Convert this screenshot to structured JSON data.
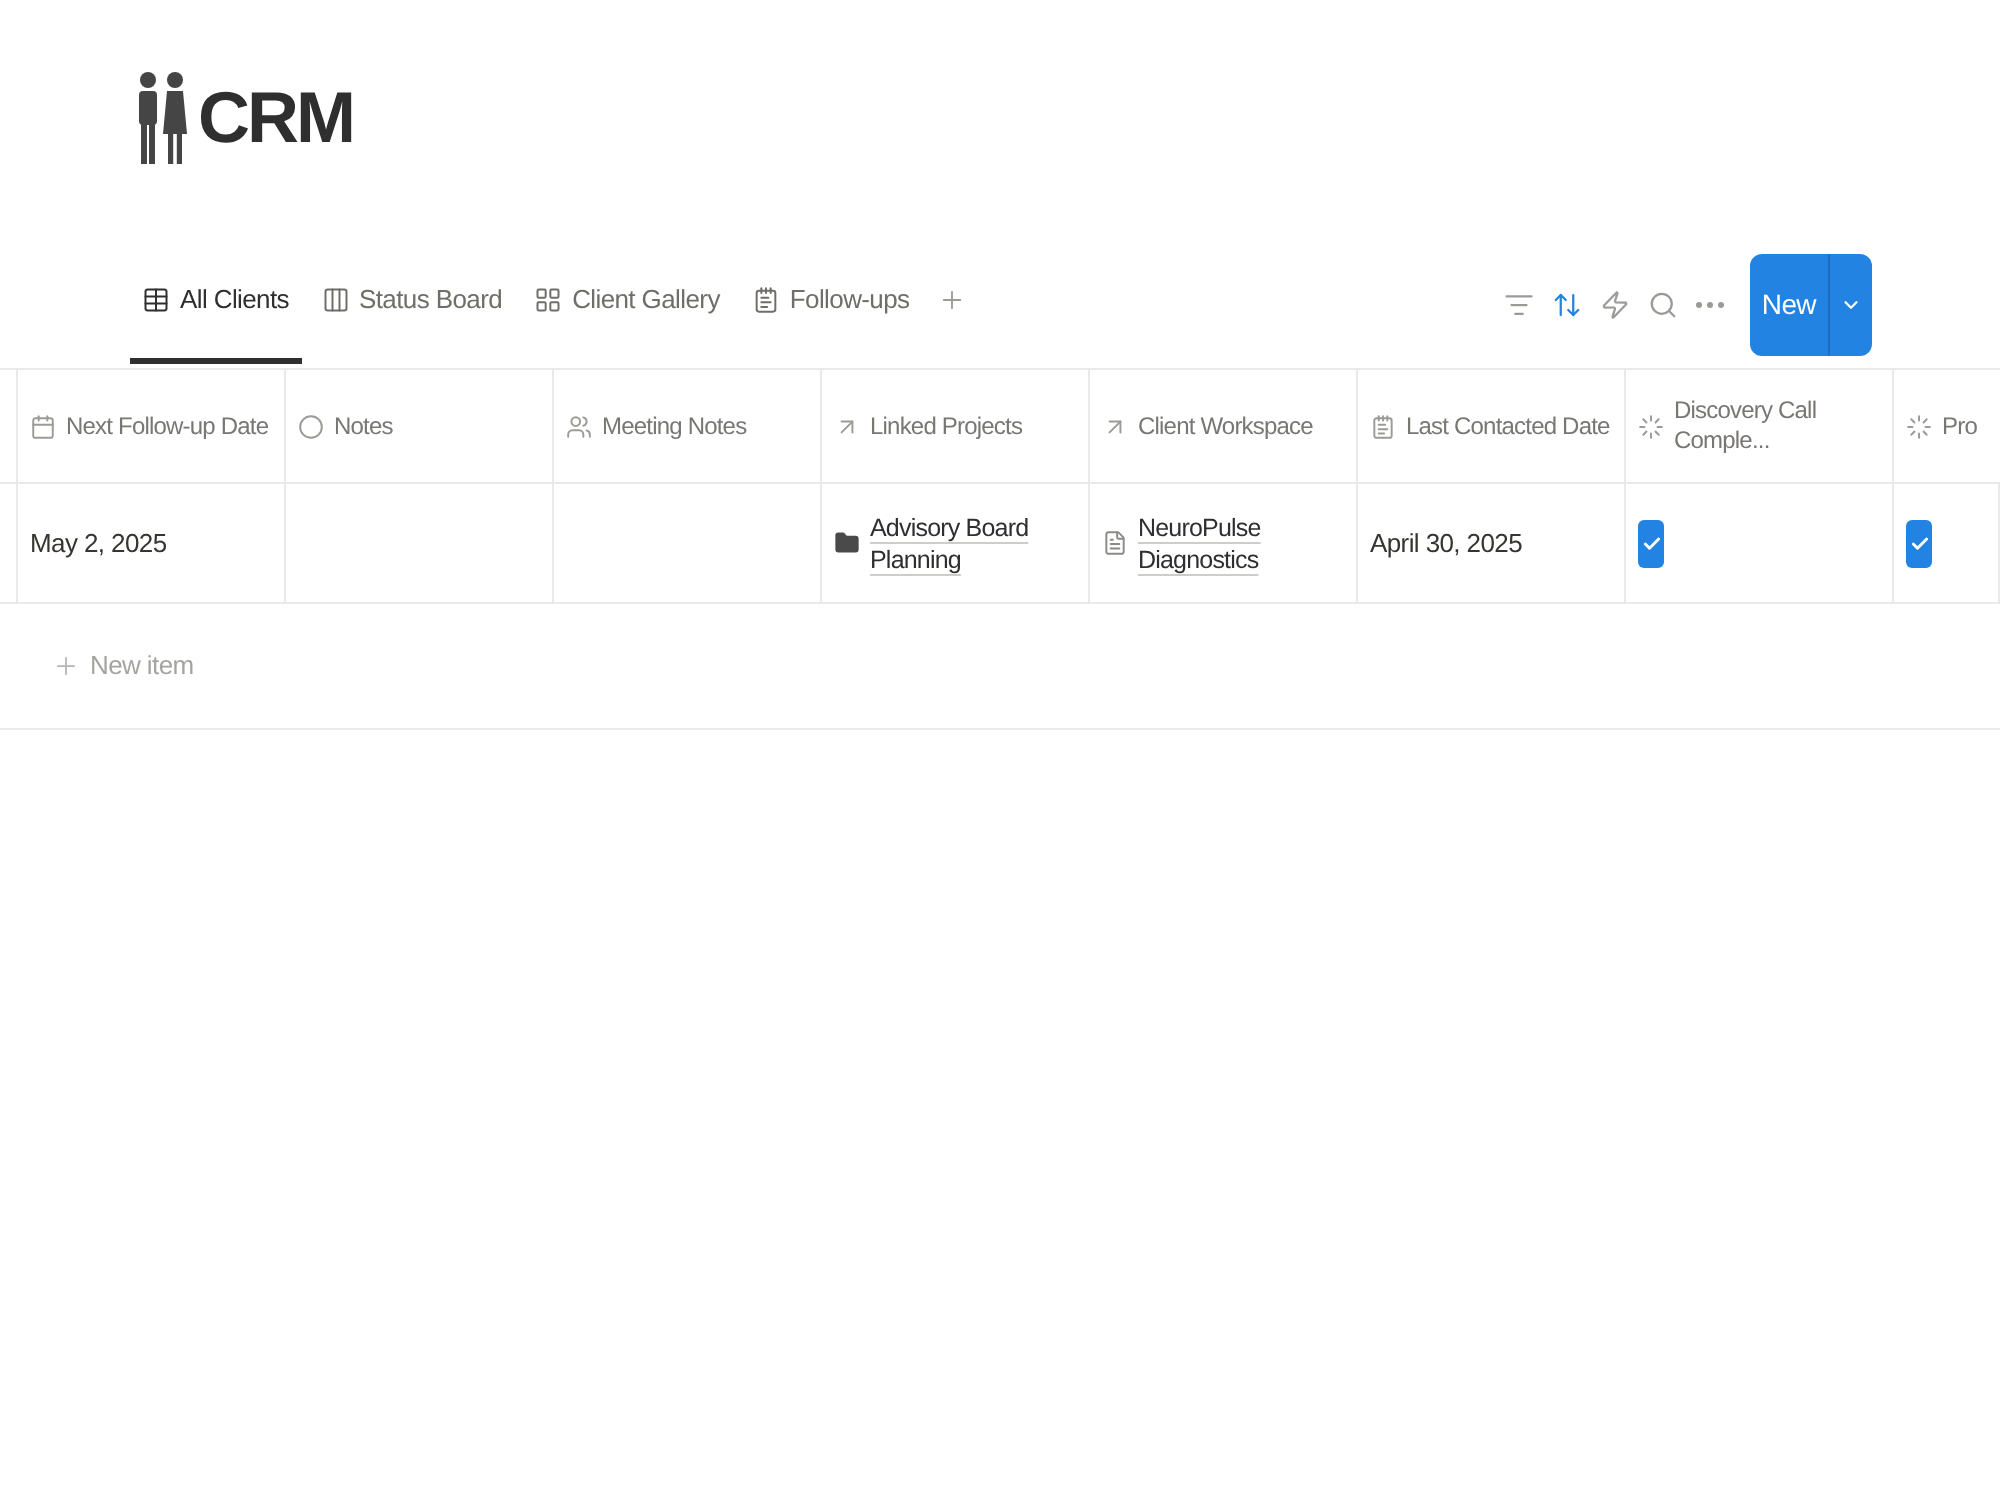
{
  "page": {
    "title": "CRM"
  },
  "views": [
    {
      "label": "All Clients",
      "kind": "table",
      "selected": true
    },
    {
      "label": "Status Board",
      "kind": "board",
      "selected": false
    },
    {
      "label": "Client Gallery",
      "kind": "gallery",
      "selected": false
    },
    {
      "label": "Follow-ups",
      "kind": "list",
      "selected": false
    }
  ],
  "toolbar": {
    "actions": [
      {
        "kind": "filter",
        "active": false
      },
      {
        "kind": "sort",
        "active": true
      },
      {
        "kind": "automation",
        "active": false
      },
      {
        "kind": "search",
        "active": false
      },
      {
        "kind": "more",
        "active": false
      }
    ],
    "new_button": {
      "label": "New"
    }
  },
  "table": {
    "columns": [
      {
        "label": "Next Follow-up Date",
        "kind": "date"
      },
      {
        "label": "Notes",
        "kind": "status"
      },
      {
        "label": "Meeting Notes",
        "kind": "people"
      },
      {
        "label": "Linked Projects",
        "kind": "relation"
      },
      {
        "label": "Client Workspace",
        "kind": "relation"
      },
      {
        "label": "Last Contacted Date",
        "kind": "notepad"
      },
      {
        "label": "Discovery Call Comple...",
        "kind": "formula"
      },
      {
        "label": "Pro",
        "kind": "formula"
      }
    ],
    "rows": [
      {
        "cells": [
          {
            "kind": "text",
            "text": "May 2, 2025"
          },
          {
            "kind": "empty"
          },
          {
            "kind": "empty"
          },
          {
            "kind": "folder",
            "text": "Advisory Board Planning"
          },
          {
            "kind": "page",
            "text": "NeuroPulse Diagnostics"
          },
          {
            "kind": "text",
            "text": "April 30, 2025"
          },
          {
            "kind": "checkbox",
            "checked": true
          },
          {
            "kind": "checkbox",
            "checked": true
          }
        ]
      }
    ],
    "new_item": {
      "label": "New item"
    }
  }
}
